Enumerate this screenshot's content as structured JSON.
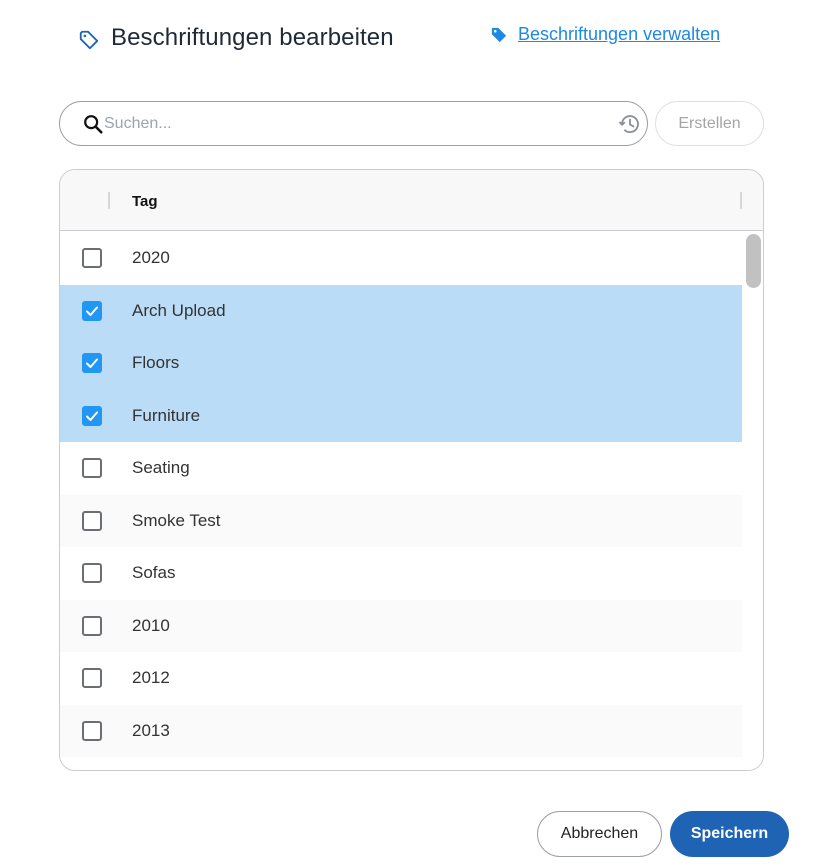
{
  "dialog": {
    "title": "Beschriftungen bearbeiten",
    "title_icon": "tag-outline-icon",
    "manage_link": {
      "label": "Beschriftungen verwalten",
      "icon": "tag-icon"
    }
  },
  "search": {
    "placeholder": "Suchen...",
    "value": "",
    "search_icon": "search-icon",
    "history_icon": "history-icon"
  },
  "create_button": {
    "label": "Erstellen",
    "enabled": false
  },
  "table": {
    "columns": [
      "Tag"
    ],
    "rows": [
      {
        "label": "2020",
        "checked": false
      },
      {
        "label": "Arch Upload",
        "checked": true
      },
      {
        "label": "Floors",
        "checked": true
      },
      {
        "label": "Furniture",
        "checked": true
      },
      {
        "label": "Seating",
        "checked": false
      },
      {
        "label": "Smoke Test",
        "checked": false
      },
      {
        "label": "Sofas",
        "checked": false
      },
      {
        "label": "2010",
        "checked": false
      },
      {
        "label": "2012",
        "checked": false
      },
      {
        "label": "2013",
        "checked": false
      }
    ]
  },
  "footer": {
    "cancel_label": "Abbrechen",
    "save_label": "Speichern"
  },
  "colors": {
    "accent": "#1e63b4",
    "link": "#1e88e5",
    "checkbox_checked": "#2196f3",
    "selected_row": "#bbdcf7"
  }
}
